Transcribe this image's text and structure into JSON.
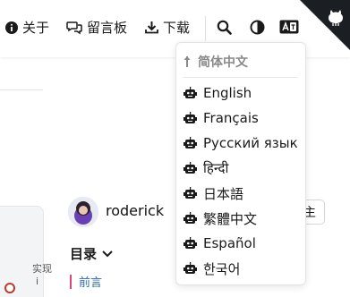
{
  "header": {
    "nav": [
      {
        "label": "关于",
        "icon": "info-circle-icon"
      },
      {
        "label": "留言板",
        "icon": "comments-icon"
      },
      {
        "label": "下载",
        "icon": "download-icon"
      }
    ],
    "tools": [
      "search-icon",
      "theme-toggle-icon",
      "language-icon"
    ],
    "corner_icon": "github-octocat-icon"
  },
  "language_menu": {
    "current": "简体中文",
    "options": [
      "English",
      "Français",
      "Русский язык",
      "हिन्दी",
      "日本語",
      "繁體中文",
      "Español",
      "한국어"
    ],
    "option_icon": "robot-icon"
  },
  "author": {
    "name": "roderick",
    "follow_label": "主"
  },
  "side_card": {
    "fragment_1": "实现",
    "fragment_2": "i"
  },
  "toc": {
    "title": "目录",
    "items": [
      "前言"
    ]
  },
  "colors": {
    "toc_link": "#2b6cb0",
    "toc_marker": "#e0457b",
    "corner": "#1b1f23"
  }
}
